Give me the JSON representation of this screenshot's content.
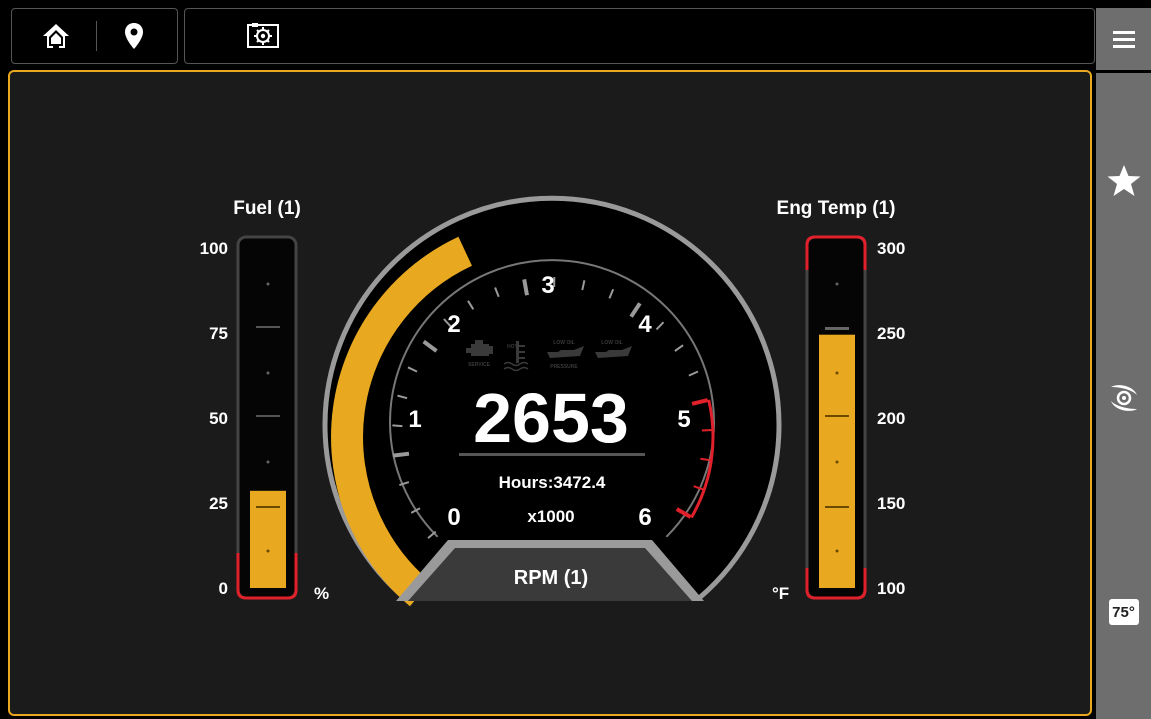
{
  "topbar": {
    "home_icon": "home-icon",
    "location_icon": "location-pin-icon",
    "settings_icon": "engine-settings-icon",
    "menu_icon": "hamburger-menu-icon"
  },
  "sidebar": {
    "favorite_icon": "star-icon",
    "propeller_icon": "propeller-icon",
    "temperature_badge": "75°"
  },
  "fuel_gauge": {
    "title": "Fuel (1)",
    "ticks": [
      "100",
      "75",
      "50",
      "25",
      "0"
    ],
    "unit": "%",
    "level_percent": 28,
    "min": 0,
    "max": 100
  },
  "rpm_gauge": {
    "value": "2653",
    "hours": "Hours:3472.4",
    "multiplier": "x1000",
    "label": "RPM (1)",
    "dial_numbers": [
      "0",
      "1",
      "2",
      "3",
      "4",
      "5",
      "6"
    ],
    "warning_icons": {
      "service": "SERVICE",
      "hot": "HOT",
      "low_oil_pressure_top": "LOW OIL",
      "low_oil_pressure_bottom": "PRESSURE",
      "low_oil": "LOW OIL"
    },
    "rpm_value": 2653,
    "max_rpm": 6000,
    "redline_start": 5000
  },
  "temp_gauge": {
    "title": "Eng Temp (1)",
    "ticks": [
      "300",
      "250",
      "200",
      "150",
      "100"
    ],
    "unit": "°F",
    "value": 246,
    "min": 100,
    "max": 300
  },
  "colors": {
    "accent": "#e8a820",
    "redline": "#e0202a",
    "panel": "#1b1b1b",
    "sidebar": "#6e6e6e"
  }
}
